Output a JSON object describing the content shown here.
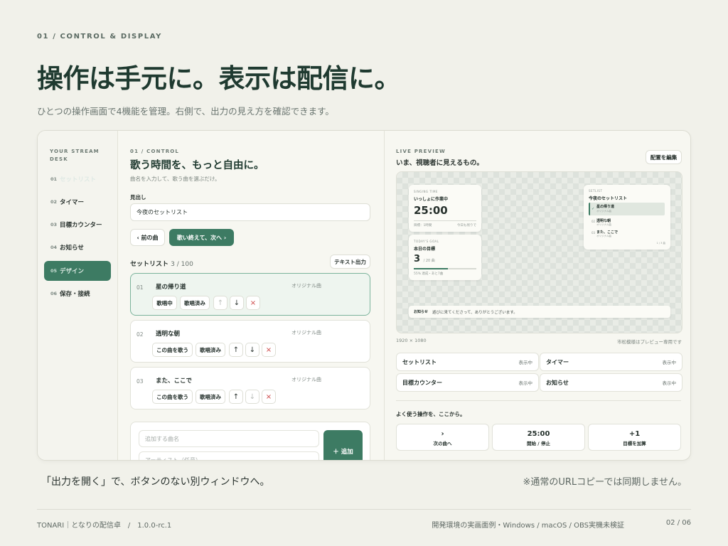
{
  "slide": {
    "kicker": "01 / CONTROL & DISPLAY",
    "headline": "操作は手元に。表示は配信に。",
    "subtitle": "ひとつの操作画面で4機能を管理。右側で、出力の見え方を確認できます。"
  },
  "sidebar": {
    "brand": "YOUR STREAM DESK",
    "items": [
      {
        "num": "01",
        "label": "セットリスト",
        "state": "ghost"
      },
      {
        "num": "02",
        "label": "タイマー",
        "state": ""
      },
      {
        "num": "03",
        "label": "目標カウンター",
        "state": ""
      },
      {
        "num": "04",
        "label": "お知らせ",
        "state": ""
      },
      {
        "num": "05",
        "label": "デザイン",
        "state": "active"
      },
      {
        "num": "06",
        "label": "保存・接続",
        "state": ""
      }
    ]
  },
  "control": {
    "kicker": "01 / CONTROL",
    "title": "歌う時間を、もっと自由に。",
    "caption": "曲名を入力して、歌う曲を選ぶだけ。",
    "field_label": "見出し",
    "field_value": "今夜のセットリスト",
    "prev_label": "‹ 前の曲",
    "next_label": "歌い終えて、次へ ›",
    "setlist_label": "セットリスト",
    "setlist_count": "3 / 100",
    "export_label": "テキスト出力",
    "songs": [
      {
        "no": "01",
        "title": "星の帰り道",
        "origin": "オリジナル曲",
        "a": "歌唱中",
        "b": "歌唱済み"
      },
      {
        "no": "02",
        "title": "透明な朝",
        "origin": "オリジナル曲",
        "a": "この曲を歌う",
        "b": "歌唱済み"
      },
      {
        "no": "03",
        "title": "また、ここで",
        "origin": "オリジナル曲",
        "a": "この曲を歌う",
        "b": "歌唱済み"
      }
    ],
    "up": "↑",
    "down": "↓",
    "del": "×",
    "add_placeholder": "追加する曲名",
    "artist_placeholder": "アーティスト（任意）",
    "add_button": "＋ 追加"
  },
  "preview": {
    "kicker": "LIVE PREVIEW",
    "title": "いま、視聴者に見えるもの。",
    "edit_label": "配置を編集",
    "resolution": "1920 × 1080",
    "note": "市松模様はプレビュー専用です",
    "timer": {
      "tk": "SINGING TIME",
      "title": "いっしょに作業中",
      "value": "25:00",
      "l": "目標：1時間",
      "r": "今日も残りで"
    },
    "goal": {
      "tk": "TODAY'S GOAL",
      "title": "本日の目標",
      "value": "3",
      "unit": "/ 20 曲",
      "l": "55% 達成・あと7曲"
    },
    "set": {
      "tk": "SETLIST",
      "title": "今夜のセットリスト",
      "s1": "星の帰り道",
      "s1s": "オリジナル曲",
      "s2": "透明な朝",
      "s2s": "オリジナル曲",
      "s3": "また、ここで",
      "s3s": "オリジナル曲",
      "foot": "1 / 3 曲"
    },
    "ticker": {
      "tag": "お知らせ",
      "text": "遊びに来てくださって、ありがとうございます。"
    },
    "status": [
      {
        "label": "セットリスト",
        "state": "表示中"
      },
      {
        "label": "タイマー",
        "state": "表示中"
      },
      {
        "label": "目標カウンター",
        "state": "表示中"
      },
      {
        "label": "お知らせ",
        "state": "表示中"
      }
    ],
    "quick_label": "よく使う操作を、ここから。",
    "quick": [
      {
        "v": "›",
        "c": "次の曲へ"
      },
      {
        "v": "25:00",
        "c": "開始 / 停止"
      },
      {
        "v": "+1",
        "c": "目標を加算"
      }
    ]
  },
  "footer": {
    "left": "「出力を開く」で、ボタンのない別ウィンドウへ。",
    "right": "※通常のURLコピーでは同期しません。",
    "product": "TONARI｜となりの配信卓　/　1.0.0-rc.1",
    "env": "開発環境の実画面例・Windows / macOS / OBS実機未検証",
    "page": "02 / 06"
  }
}
